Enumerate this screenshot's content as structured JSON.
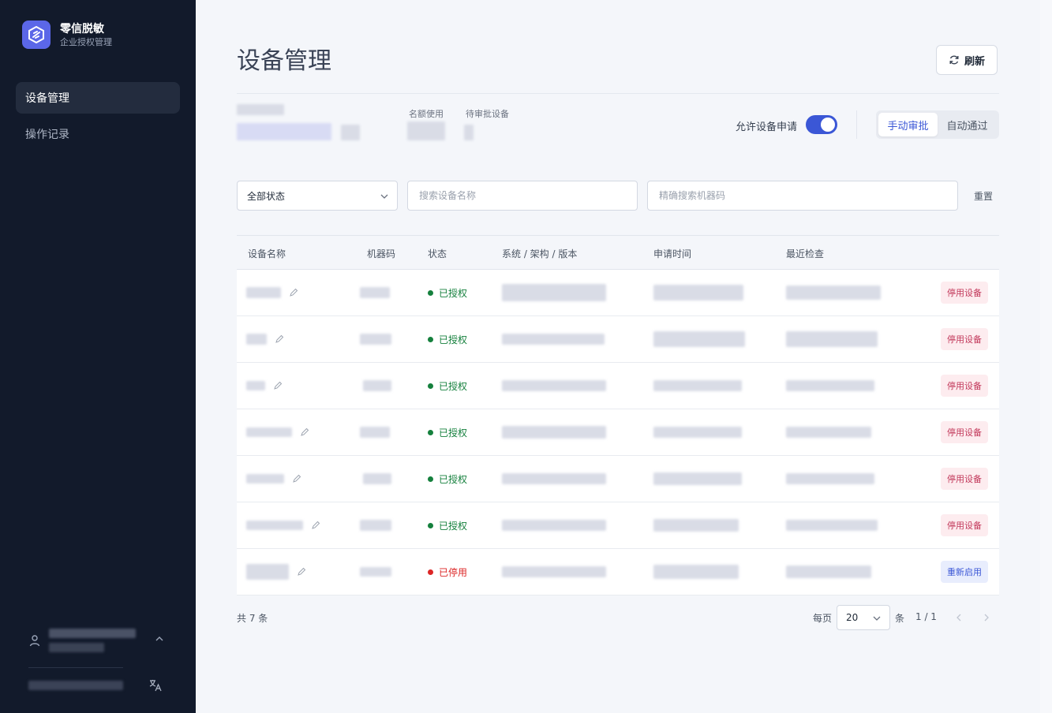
{
  "brand": {
    "name": "零信脱敏",
    "subtitle": "企业授权管理"
  },
  "sidebar": {
    "items": [
      {
        "label": "设备管理",
        "active": true
      },
      {
        "label": "操作记录",
        "active": false
      }
    ]
  },
  "page": {
    "title": "设备管理",
    "refresh_label": "刷新"
  },
  "stats": {
    "quota_label": "名额使用",
    "pending_label": "待审批设备"
  },
  "approval": {
    "allow_label": "允许设备申请",
    "allow_enabled": true,
    "modes": [
      "手动审批",
      "自动通过"
    ],
    "active_mode": "手动审批"
  },
  "filters": {
    "status_value": "全部状态",
    "name_placeholder": "搜索设备名称",
    "code_placeholder": "精确搜索机器码",
    "reset_label": "重置"
  },
  "table": {
    "columns": [
      "设备名称",
      "机器码",
      "状态",
      "系统 / 架构 / 版本",
      "申请时间",
      "最近检查"
    ],
    "rows": [
      {
        "status": "已授权",
        "action": "停用设备"
      },
      {
        "status": "已授权",
        "action": "停用设备"
      },
      {
        "status": "已授权",
        "action": "停用设备"
      },
      {
        "status": "已授权",
        "action": "停用设备"
      },
      {
        "status": "已授权",
        "action": "停用设备"
      },
      {
        "status": "已授权",
        "action": "停用设备"
      },
      {
        "status": "已停用",
        "action": "重新启用"
      }
    ]
  },
  "pagination": {
    "total_label": "共 7 条",
    "per_page_label": "每页",
    "per_page_value": "20",
    "per_page_unit": "条",
    "page_info": "1 / 1"
  },
  "colors": {
    "accent": "#3b57d6",
    "authorized": "#15803d",
    "disabled": "#dc2626",
    "danger_btn_bg": "#fdecef",
    "danger_btn_text": "#c2375a",
    "enable_btn_bg": "#e8edfd",
    "enable_btn_text": "#3b57d6"
  }
}
